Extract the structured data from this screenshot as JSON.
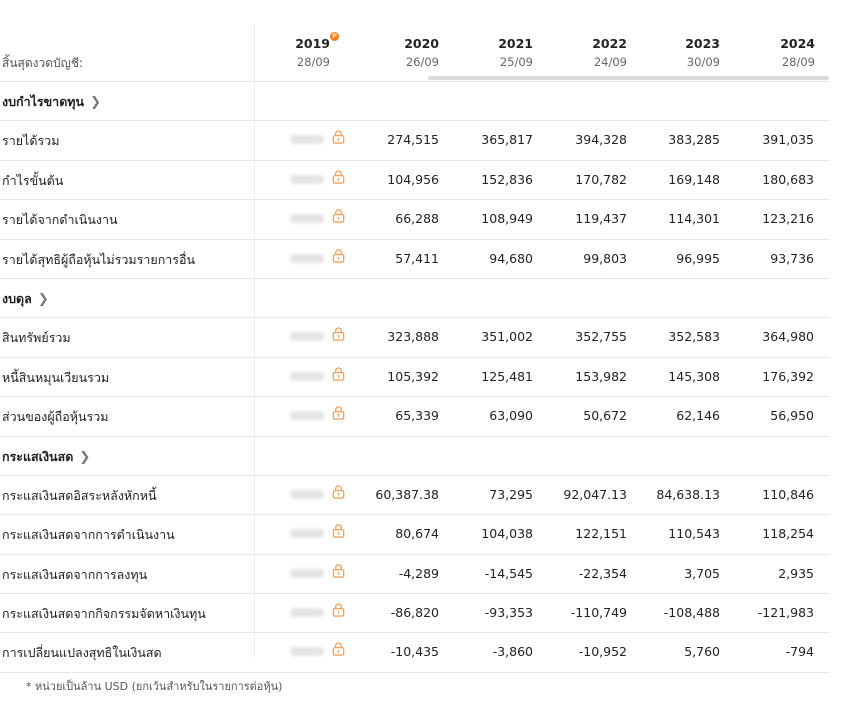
{
  "header": {
    "period_label": "สิ้นสุดงวดบัญชี:",
    "columns": [
      {
        "year": "2019",
        "date": "28/09",
        "pro": true
      },
      {
        "year": "2020",
        "date": "26/09"
      },
      {
        "year": "2021",
        "date": "25/09"
      },
      {
        "year": "2022",
        "date": "24/09"
      },
      {
        "year": "2023",
        "date": "30/09"
      },
      {
        "year": "2024",
        "date": "28/09"
      }
    ]
  },
  "sections": [
    {
      "title": "งบกำไรขาดทุน",
      "rows": [
        {
          "label": "รายได้รวม",
          "values": [
            "274,515",
            "365,817",
            "394,328",
            "383,285",
            "391,035"
          ]
        },
        {
          "label": "กำไรขั้นต้น",
          "values": [
            "104,956",
            "152,836",
            "170,782",
            "169,148",
            "180,683"
          ]
        },
        {
          "label": "รายได้จากดำเนินงาน",
          "values": [
            "66,288",
            "108,949",
            "119,437",
            "114,301",
            "123,216"
          ]
        },
        {
          "label": "รายได้สุทธิผู้ถือหุ้นไม่รวมรายการอื่น",
          "values": [
            "57,411",
            "94,680",
            "99,803",
            "96,995",
            "93,736"
          ]
        }
      ]
    },
    {
      "title": "งบดุล",
      "rows": [
        {
          "label": "สินทรัพย์รวม",
          "values": [
            "323,888",
            "351,002",
            "352,755",
            "352,583",
            "364,980"
          ]
        },
        {
          "label": "หนี้สินหมุนเวียนรวม",
          "values": [
            "105,392",
            "125,481",
            "153,982",
            "145,308",
            "176,392"
          ]
        },
        {
          "label": "ส่วนของผู้ถือหุ้นรวม",
          "values": [
            "65,339",
            "63,090",
            "50,672",
            "62,146",
            "56,950"
          ]
        }
      ]
    },
    {
      "title": "กระแสเงินสด",
      "rows": [
        {
          "label": "กระแสเงินสดอิสระหลังหักหนี้",
          "values": [
            "60,387.38",
            "73,295",
            "92,047.13",
            "84,638.13",
            "110,846"
          ]
        },
        {
          "label": "กระแสเงินสดจากการดำเนินงาน",
          "values": [
            "80,674",
            "104,038",
            "122,151",
            "110,543",
            "118,254"
          ]
        },
        {
          "label": "กระแสเงินสดจากการลงทุน",
          "values": [
            "-4,289",
            "-14,545",
            "-22,354",
            "3,705",
            "2,935"
          ]
        },
        {
          "label": "กระแสเงินสดจากกิจกรรมจัดหาเงินทุน",
          "values": [
            "-86,820",
            "-93,353",
            "-110,749",
            "-108,488",
            "-121,983"
          ]
        },
        {
          "label": "การเปลี่ยนแปลงสุทธิในเงินสด",
          "values": [
            "-10,435",
            "-3,860",
            "-10,952",
            "5,760",
            "-794"
          ]
        }
      ]
    }
  ],
  "footnote": "* หน่วยเป็นล้าน USD (ยกเว้นสำหรับในรายการต่อหุ้น)",
  "colors": {
    "accent": "#ff8a1f",
    "border": "#e6e6e6"
  },
  "icons": {
    "lock": "lock-icon",
    "chevron": "chevron-right-icon",
    "pro": "pro-badge-icon"
  }
}
